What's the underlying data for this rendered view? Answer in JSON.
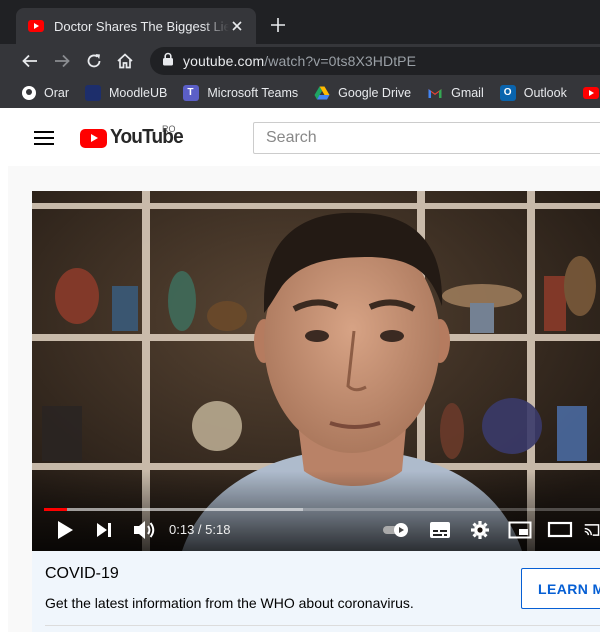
{
  "browser": {
    "tab": {
      "title": "Doctor Shares The Biggest Lie About"
    },
    "address_bar": {
      "host": "youtube.com",
      "path": "/watch?v=0ts8X3HDtPE"
    },
    "bookmarks": [
      {
        "label": "Orar",
        "icon": "orar-favicon",
        "color": "#ffffff"
      },
      {
        "label": "MoodleUB",
        "icon": "moodle-favicon",
        "color": "#1d2e6b"
      },
      {
        "label": "Microsoft Teams",
        "icon": "teams-favicon",
        "color": "#5b5fc7"
      },
      {
        "label": "Google Drive",
        "icon": "google-drive-favicon",
        "color": "#1fa463"
      },
      {
        "label": "Gmail",
        "icon": "gmail-favicon",
        "color": "#ea4335"
      },
      {
        "label": "Outlook",
        "icon": "outlook-favicon",
        "color": "#0a64ad"
      },
      {
        "label": "",
        "icon": "youtube-favicon",
        "color": "#ff0000"
      }
    ]
  },
  "youtube": {
    "logo_text": "YouTube",
    "region": "RO",
    "search_placeholder": "Search",
    "brand_color": "#ff0000"
  },
  "player": {
    "current_time": "0:13",
    "duration": "5:18",
    "played_fraction": 0.041,
    "buffered_fraction": 0.465
  },
  "covid_panel": {
    "title": "COVID-19",
    "description": "Get the latest information from the WHO about coronavirus.",
    "button_label": "LEARN MORE",
    "accent_color": "#065fd4"
  }
}
